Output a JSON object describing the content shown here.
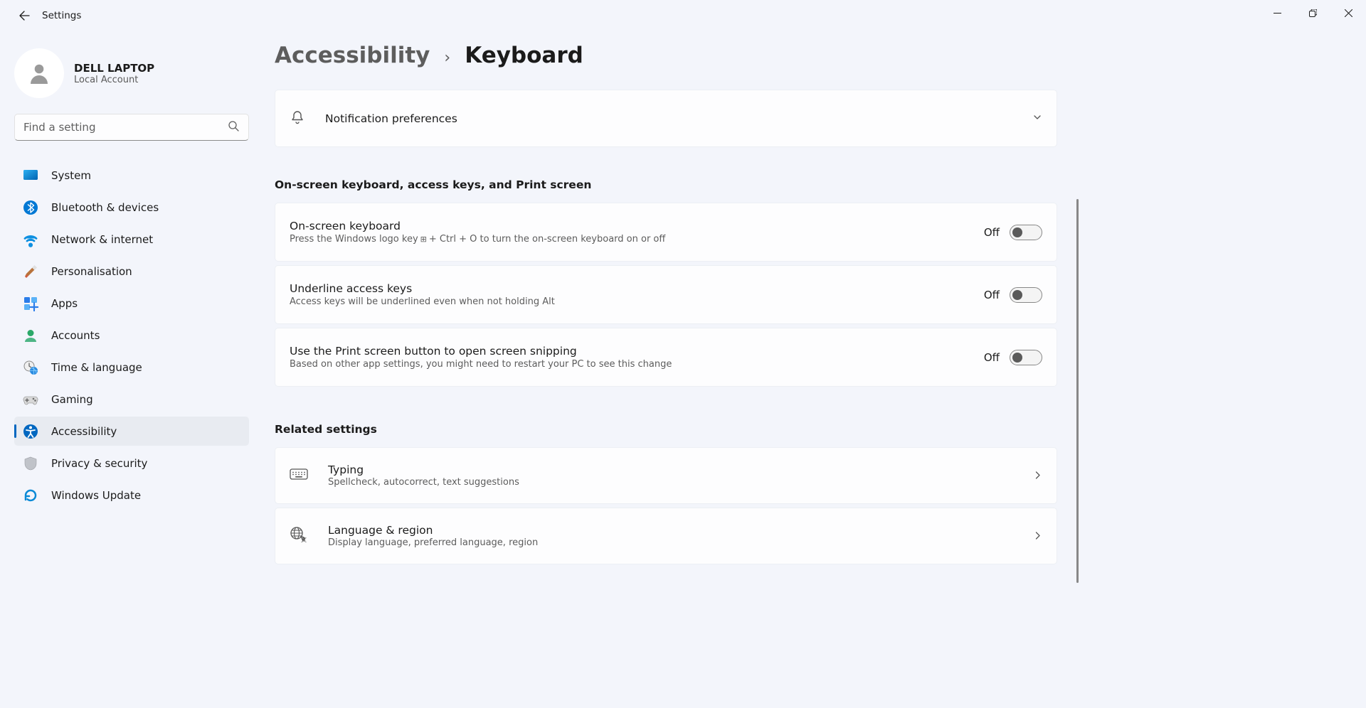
{
  "app_title": "Settings",
  "account": {
    "name": "DELL LAPTOP",
    "type": "Local Account"
  },
  "search": {
    "placeholder": "Find a setting"
  },
  "nav": {
    "items": [
      {
        "label": "System"
      },
      {
        "label": "Bluetooth & devices"
      },
      {
        "label": "Network & internet"
      },
      {
        "label": "Personalisation"
      },
      {
        "label": "Apps"
      },
      {
        "label": "Accounts"
      },
      {
        "label": "Time & language"
      },
      {
        "label": "Gaming"
      },
      {
        "label": "Accessibility"
      },
      {
        "label": "Privacy & security"
      },
      {
        "label": "Windows Update"
      }
    ]
  },
  "breadcrumb": {
    "parent": "Accessibility",
    "current": "Keyboard"
  },
  "expander": {
    "title": "Notification preferences"
  },
  "section1_header": "On-screen keyboard, access keys, and Print screen",
  "toggles": [
    {
      "title": "On-screen keyboard",
      "sub_pre": "Press the Windows logo key ",
      "sub_post": " + Ctrl + O to turn the on-screen keyboard on or off",
      "state": "Off"
    },
    {
      "title": "Underline access keys",
      "sub": "Access keys will be underlined even when not holding Alt",
      "state": "Off"
    },
    {
      "title": "Use the Print screen button to open screen snipping",
      "sub": "Based on other app settings, you might need to restart your PC to see this change",
      "state": "Off"
    }
  ],
  "section2_header": "Related settings",
  "links": [
    {
      "title": "Typing",
      "sub": "Spellcheck, autocorrect, text suggestions"
    },
    {
      "title": "Language & region",
      "sub": "Display language, preferred language, region"
    }
  ]
}
